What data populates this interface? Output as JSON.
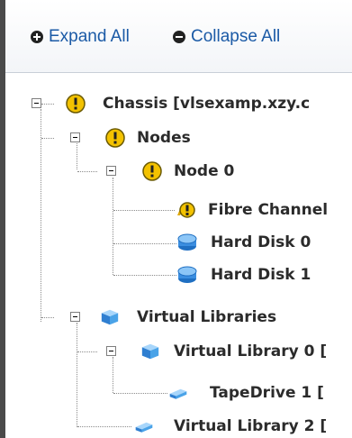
{
  "toolbar": {
    "expand_label": "Expand All",
    "collapse_label": "Collapse All"
  },
  "tree": {
    "chassis": "Chassis [vlsexamp.xzy.c",
    "nodes": "Nodes",
    "node0": "Node 0",
    "fibre_channel": "Fibre Channel",
    "hard_disk_0": "Hard Disk 0",
    "hard_disk_1": "Hard Disk 1",
    "virtual_libraries": "Virtual Libraries",
    "virtual_library_0": "Virtual Library 0 [",
    "tapedrive_1": "TapeDrive 1 [",
    "virtual_library_2": "Virtual Library 2 ["
  },
  "colors": {
    "link": "#1b5aa6",
    "warning": "#f3c200",
    "disk": "#3b8ee0",
    "library": "#4aa3e8"
  }
}
